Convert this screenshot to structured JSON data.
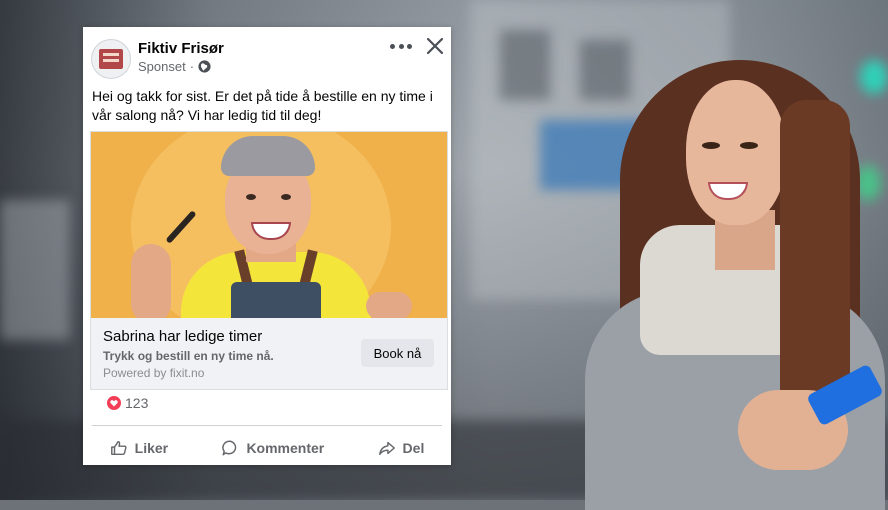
{
  "post": {
    "page_name": "Fiktiv Frisør",
    "sponsored_label": "Sponset",
    "text": "Hei og takk for sist. Er det på tide å bestille en ny time i vår salong nå? Vi har ledig tid til deg!"
  },
  "ad": {
    "headline": "Sabrina har ledige timer",
    "description": "Trykk og bestill en ny time nå.",
    "powered_by": "Powered by fixit.no",
    "cta_label": "Book nå"
  },
  "reactions": {
    "count": "123",
    "icon": "heart-icon",
    "color": "#f33e58"
  },
  "actions": {
    "like": "Liker",
    "comment": "Kommenter",
    "share": "Del"
  }
}
